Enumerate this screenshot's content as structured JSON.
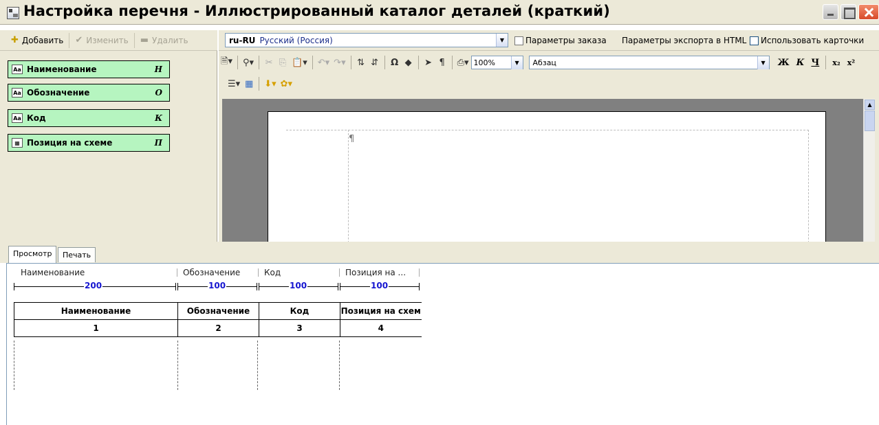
{
  "window": {
    "title": "Настройка перечня - Иллюстрированный каталог деталей (краткий)"
  },
  "left_toolbar": {
    "add": "Добавить",
    "edit": "Изменить",
    "delete": "Удалить"
  },
  "fields": [
    {
      "label": "Наименование",
      "key": "Н",
      "icon": "text-field-icon"
    },
    {
      "label": "Обозначение",
      "key": "О",
      "icon": "text-field-icon"
    },
    {
      "label": "Код",
      "key": "К",
      "icon": "text-field-icon"
    },
    {
      "label": "Позиция на схеме",
      "key": "П",
      "icon": "diagram-position-icon"
    }
  ],
  "lang_bar": {
    "code": "ru-RU",
    "name": "Русский (Россия)",
    "order_params": "Параметры заказа",
    "export_params": "Параметры экспорта в HTML",
    "use_cards": "Использовать карточки"
  },
  "editor": {
    "zoom": "100%",
    "style": "Абзац",
    "pilcrow": "¶"
  },
  "tabs": [
    "Просмотр",
    "Печать"
  ],
  "preview": {
    "col_headers": [
      "Наименование",
      "Обозначение",
      "Код",
      "Позиция на ..."
    ],
    "widths": [
      "200",
      "100",
      "100",
      "100"
    ],
    "table_header": [
      "Наименование",
      "Обозначение",
      "Код",
      "Позиция на схем"
    ],
    "table_numbers": [
      "1",
      "2",
      "3",
      "4"
    ]
  }
}
